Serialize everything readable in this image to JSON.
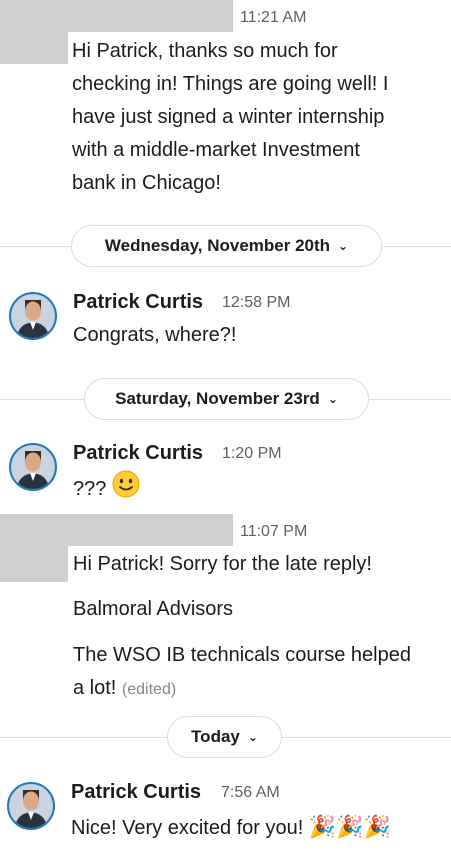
{
  "messages": [
    {
      "time": "11:21 AM",
      "lines": [
        "Hi Patrick, thanks so much for",
        "checking in! Things are going well! I",
        "have just signed a winter internship",
        "with a middle-market Investment",
        "bank in Chicago!"
      ]
    },
    {
      "author": "Patrick Curtis",
      "time": "12:58 PM",
      "text": "Congrats, where?!"
    },
    {
      "author": "Patrick Curtis",
      "time": "1:20 PM",
      "text": "???"
    },
    {
      "time": "11:07 PM",
      "text1": "Hi Patrick! Sorry for the late reply!",
      "text2": "Balmoral Advisors",
      "text3_line1": "The WSO IB technicals course helped",
      "text3_line2": "a lot!",
      "edited": "(edited)"
    },
    {
      "author": "Patrick Curtis",
      "time": "7:56 AM",
      "text": "Nice!  Very excited for you!"
    }
  ],
  "dividers": [
    "Wednesday, November 20th",
    "Saturday, November 23rd",
    "Today"
  ],
  "icons": {
    "chevron": "chevron-down-icon",
    "smiley": "slightly-smiling-face-icon",
    "party": "party-popper-icon"
  },
  "colors": {
    "avatar_ring": "#1e7ab8",
    "redaction": "#cfcfcf"
  }
}
